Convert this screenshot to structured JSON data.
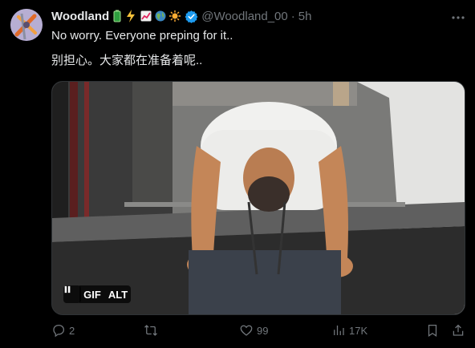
{
  "tweet": {
    "author_name": "Woodland",
    "author_handle": "@Woodland_00",
    "separator": "·",
    "time": "5h",
    "name_emojis": [
      "battery-emoji",
      "lightning-emoji",
      "chart-up-emoji",
      "globe-emoji",
      "sun-emoji"
    ],
    "verified": true,
    "text_line1": "No worry. Everyone preping for it..",
    "text_line2": "别担心。大家都在准备着呢.."
  },
  "media": {
    "type": "gif",
    "pause_icon": "pause-icon",
    "gif_label": "GIF",
    "alt_label": "ALT"
  },
  "actions": {
    "reply_count": "2",
    "retweet_count": "",
    "like_count": "99",
    "views_count": "17K"
  },
  "colors": {
    "background": "#000000",
    "text": "#e7e9ea",
    "muted": "#71767b",
    "verified": "#1d9bf0"
  }
}
